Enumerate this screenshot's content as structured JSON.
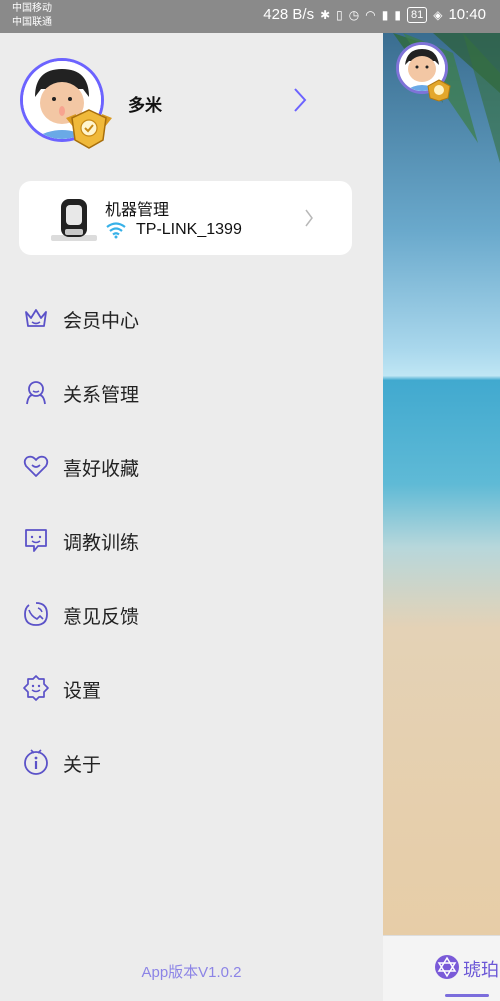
{
  "status_bar": {
    "carrier1": "中国移动",
    "carrier2": "中国联通",
    "speed": "428 B/s",
    "battery": "81",
    "time": "10:40",
    "icons": [
      "bluetooth-icon",
      "vibrate-icon",
      "alarm-icon",
      "wifi-icon",
      "signal-2g-icon",
      "signal-h-icon",
      "battery-icon",
      "leaf-icon"
    ]
  },
  "profile": {
    "username": "多米"
  },
  "device": {
    "title": "机器管理",
    "wifi": "TP-LINK_1399"
  },
  "menu": [
    {
      "label": "会员中心",
      "icon": "crown-icon"
    },
    {
      "label": "关系管理",
      "icon": "person-icon"
    },
    {
      "label": "喜好收藏",
      "icon": "heart-face-icon"
    },
    {
      "label": "调教训练",
      "icon": "chat-face-icon"
    },
    {
      "label": "意见反馈",
      "icon": "feedback-icon"
    },
    {
      "label": "设置",
      "icon": "settings-icon"
    },
    {
      "label": "关于",
      "icon": "info-icon"
    }
  ],
  "version": "App版本V1.0.2",
  "bottom_tab": {
    "label": "琥珀"
  },
  "colors": {
    "accent": "#6c63ff",
    "icon_stroke": "#5b52c8",
    "version_text": "#8c84e6",
    "status_bar": "#8a8a8a",
    "drawer_bg": "#ececec"
  }
}
